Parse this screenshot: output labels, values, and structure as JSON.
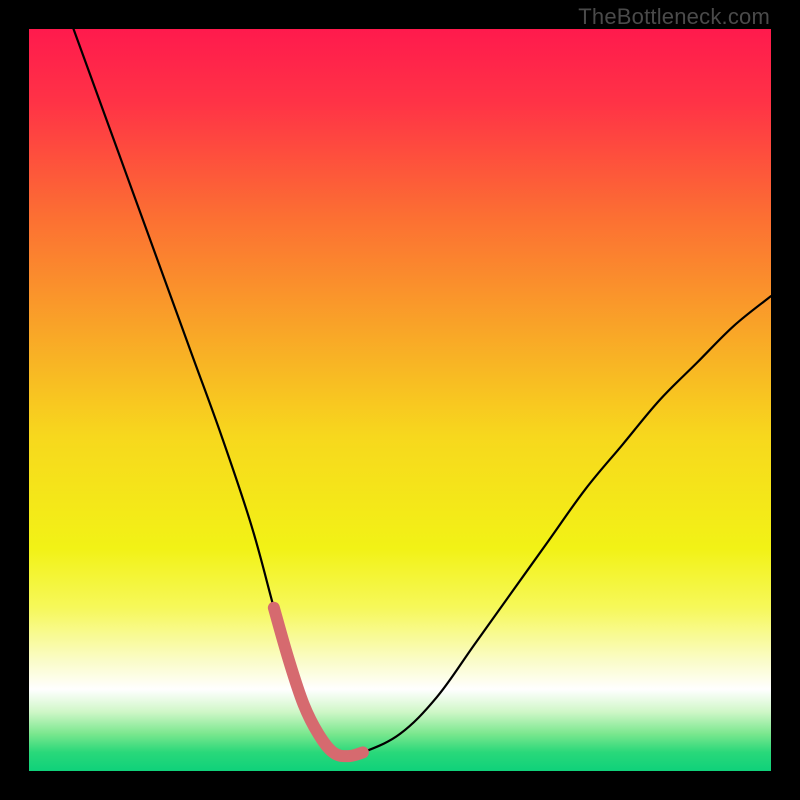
{
  "watermark": "TheBottleneck.com",
  "colors": {
    "black": "#000000",
    "curve": "#000000",
    "highlight": "#d66a6f",
    "gradient_stops": [
      {
        "offset": 0.0,
        "color": "#ff1a4d"
      },
      {
        "offset": 0.1,
        "color": "#ff3346"
      },
      {
        "offset": 0.25,
        "color": "#fc6e33"
      },
      {
        "offset": 0.4,
        "color": "#f9a328"
      },
      {
        "offset": 0.55,
        "color": "#f7d81d"
      },
      {
        "offset": 0.7,
        "color": "#f2f216"
      },
      {
        "offset": 0.78,
        "color": "#f6f85a"
      },
      {
        "offset": 0.85,
        "color": "#fafcc6"
      },
      {
        "offset": 0.89,
        "color": "#ffffff"
      },
      {
        "offset": 0.92,
        "color": "#d0f7c8"
      },
      {
        "offset": 0.95,
        "color": "#7ae78e"
      },
      {
        "offset": 0.975,
        "color": "#29d87a"
      },
      {
        "offset": 1.0,
        "color": "#0fd17a"
      }
    ]
  },
  "chart_data": {
    "type": "line",
    "title": "",
    "xlabel": "",
    "ylabel": "",
    "xlim": [
      0,
      100
    ],
    "ylim": [
      0,
      100
    ],
    "series": [
      {
        "name": "bottleneck-curve",
        "x": [
          6,
          10,
          14,
          18,
          22,
          26,
          30,
          33,
          35,
          37,
          39,
          41,
          43,
          45,
          50,
          55,
          60,
          65,
          70,
          75,
          80,
          85,
          90,
          95,
          100
        ],
        "values": [
          100,
          89,
          78,
          67,
          56,
          45,
          33,
          22,
          15,
          9,
          5,
          2.5,
          2,
          2.5,
          5,
          10,
          17,
          24,
          31,
          38,
          44,
          50,
          55,
          60,
          64
        ]
      }
    ],
    "highlight_range_x": [
      33,
      46
    ],
    "annotations": []
  }
}
